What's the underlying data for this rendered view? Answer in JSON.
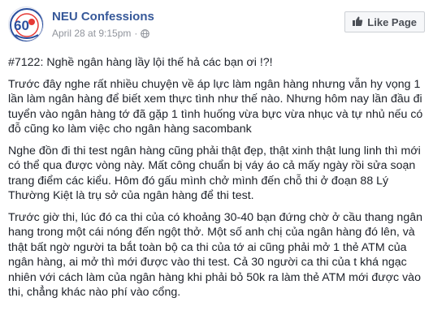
{
  "header": {
    "page_name": "NEU Confessions",
    "date": "April 28 at 9:15pm",
    "separator": "·",
    "privacy_icon": "globe-icon",
    "avatar_number": "60",
    "like_button_label": "Like Page",
    "like_button_icon": "thumbs-up-icon"
  },
  "post": {
    "title": "#7122: Nghề ngân hàng lầy lội thế hả các bạn ơi !?!",
    "paragraphs": [
      "Trước đây nghe rất nhiều chuyện về áp lực làm ngân hàng nhưng vẫn hy vọng 1 lần làm ngân hàng để biết xem thực tình như thế nào. Nhưng hôm nay lần đầu đi tuyển vào ngân hàng tớ đã gặp 1 tình huống vừa bực vừa nhục và tự nhủ nếu có đỗ cũng ko làm việc cho ngân hàng sacombank",
      "Nghe đồn đi thi test ngân hàng cũng phải thật đẹp, thật xinh thật lung linh thì mới có thể qua được vòng này. Mất công chuẩn bị váy áo cả mấy ngày rồi sửa soạn trang điểm các kiểu. Hôm đó gấu mình chở mình đến chỗ thi ở đoạn 88 Lý Thường Kiệt là trụ sở của ngân hàng để thi test.",
      "Trước giờ thi, lúc đó ca thi của có khoảng 30-40 bạn đứng chờ ở cầu thang ngân hang trong một cái nóng đến ngột thở. Một số anh chị của ngân hàng đó lên, và thật bất ngờ người ta bắt toàn bộ ca thi của tớ ai cũng phải mở 1 thẻ ATM của ngân hàng, ai mở thì mới được vào thi test. Cả 30 người ca thi của t khá ngạc nhiên với cách làm của ngân hàng khi phải bỏ 50k ra làm thẻ ATM mới được vào thi, chẳng khác nào phí vào cổng."
    ]
  },
  "colors": {
    "link_blue": "#365899",
    "meta_gray": "#90949c",
    "text": "#1d2129"
  }
}
